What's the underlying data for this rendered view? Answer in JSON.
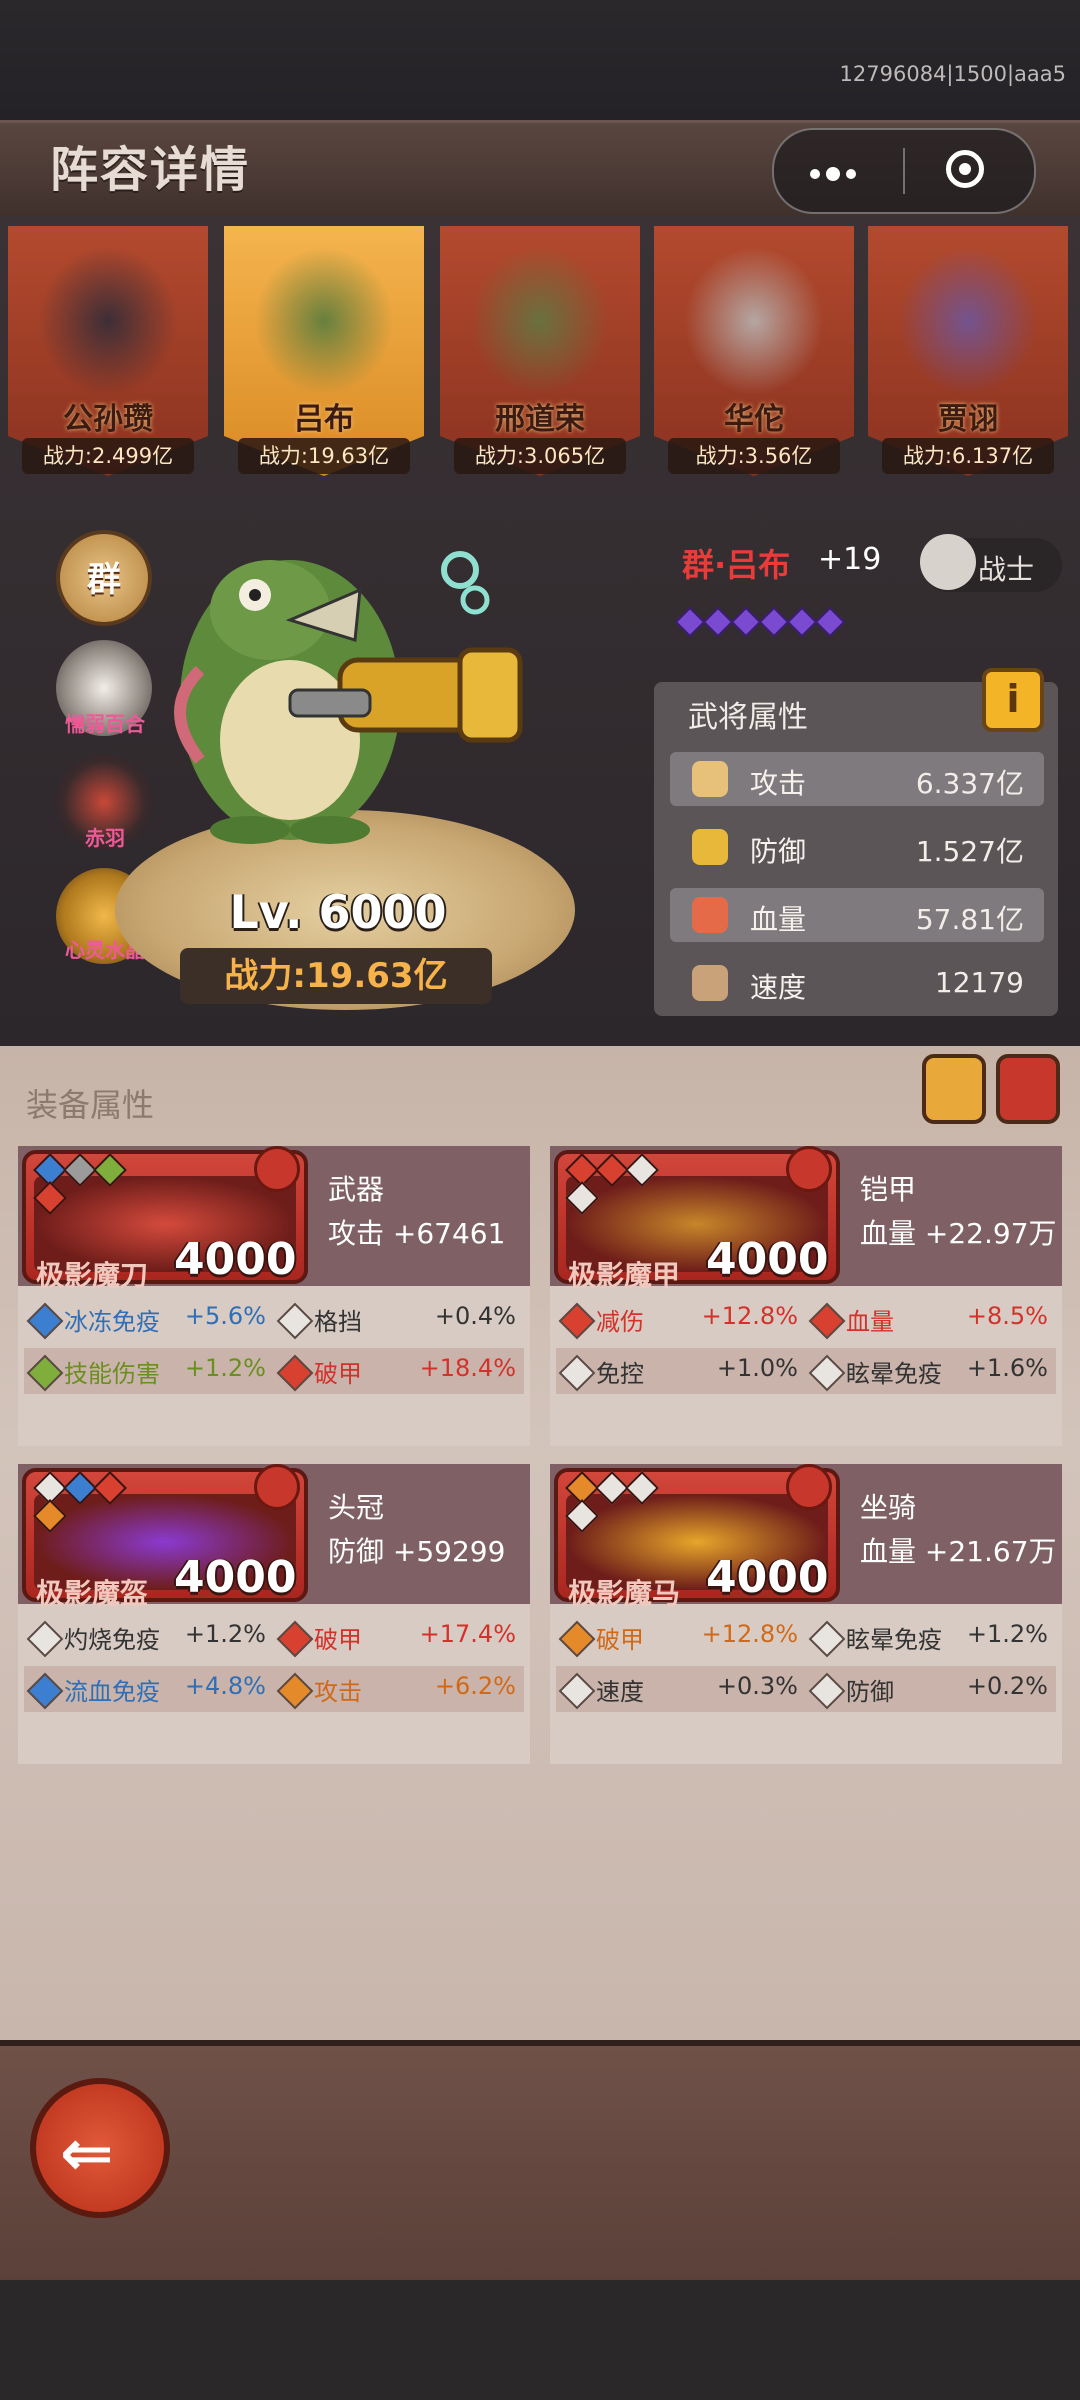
{
  "debug_text": "12796084|1500|aaa5",
  "title": "阵容详情",
  "capsule": {
    "more_icon": "more-dots-icon",
    "close_icon": "target-icon"
  },
  "heroes": [
    {
      "name": "公孙瓒",
      "power": "战力:2.499亿",
      "selected": false,
      "color": "#2b2b3a"
    },
    {
      "name": "吕布",
      "power": "战力:19.63亿",
      "selected": true,
      "color": "#4f7a3e"
    },
    {
      "name": "邢道荣",
      "power": "战力:3.065亿",
      "selected": false,
      "color": "#5f7a42"
    },
    {
      "name": "华佗",
      "power": "战力:3.56亿",
      "selected": false,
      "color": "#b8b8b8"
    },
    {
      "name": "贾诩",
      "power": "战力:6.137亿",
      "selected": false,
      "color": "#6b57a0"
    }
  ],
  "side": {
    "faction": "群",
    "skills": [
      {
        "label": "懦弱百合",
        "icon": "lily-icon"
      },
      {
        "label": "赤羽",
        "icon": "red-feather-icon"
      },
      {
        "label": "心灵水晶",
        "icon": "crystal-skull-icon"
      }
    ]
  },
  "hero_level": "Lv. 6000",
  "hero_power": "战力:19.63亿",
  "hero_title": "群·吕布",
  "hero_plus": "+19",
  "hero_class": "战士",
  "stats_panel": {
    "title": "武将属性",
    "info_label": "i",
    "stats": [
      {
        "name": "攻击",
        "value": "6.337亿",
        "icon": "sword-icon",
        "highlight": true
      },
      {
        "name": "防御",
        "value": "1.527亿",
        "icon": "shield-icon",
        "highlight": false
      },
      {
        "name": "血量",
        "value": "57.81亿",
        "icon": "blood-drop-icon",
        "highlight": true
      },
      {
        "name": "速度",
        "value": "12179",
        "icon": "boot-icon",
        "highlight": false
      }
    ]
  },
  "equipment": {
    "title": "装备属性",
    "items": [
      {
        "name": "极影魔刀",
        "level": "4000",
        "slot": "武器",
        "bonus": "攻击  +67461",
        "gems": [
          "#3c7fd1",
          "#9b9b9b",
          "#7fae3c",
          "#d84030"
        ],
        "subs": [
          [
            {
              "label": "冰冻免疫",
              "value": "+5.6%",
              "color": "#2f6fb7",
              "gem": "#3c7fd1"
            },
            {
              "label": "格挡",
              "value": "+0.4%",
              "color": "#333333",
              "gem": "#e8e4e0"
            }
          ],
          [
            {
              "label": "技能伤害",
              "value": "+1.2%",
              "color": "#6b8f1f",
              "gem": "#7fae3c"
            },
            {
              "label": "破甲",
              "value": "+18.4%",
              "color": "#d3322a",
              "gem": "#d84030"
            }
          ]
        ]
      },
      {
        "name": "极影魔甲",
        "level": "4000",
        "slot": "铠甲",
        "bonus": "血量 +22.97万",
        "gems": [
          "#d84030",
          "#d84030",
          "#e8e4e0",
          "#e8e4e0"
        ],
        "subs": [
          [
            {
              "label": "减伤",
              "value": "+12.8%",
              "color": "#d3322a",
              "gem": "#d84030"
            },
            {
              "label": "血量",
              "value": "+8.5%",
              "color": "#d3322a",
              "gem": "#d84030"
            }
          ],
          [
            {
              "label": "免控",
              "value": "+1.0%",
              "color": "#333333",
              "gem": "#e8e4e0"
            },
            {
              "label": "眩晕免疫",
              "value": "+1.6%",
              "color": "#333333",
              "gem": "#e8e4e0"
            }
          ]
        ]
      },
      {
        "name": "极影魔盔",
        "level": "4000",
        "slot": "头冠",
        "bonus": "防御  +59299",
        "gems": [
          "#e8e4e0",
          "#3c7fd1",
          "#d84030",
          "#e58a2a"
        ],
        "subs": [
          [
            {
              "label": "灼烧免疫",
              "value": "+1.2%",
              "color": "#333333",
              "gem": "#e8e4e0"
            },
            {
              "label": "破甲",
              "value": "+17.4%",
              "color": "#d3322a",
              "gem": "#d84030"
            }
          ],
          [
            {
              "label": "流血免疫",
              "value": "+4.8%",
              "color": "#2f6fb7",
              "gem": "#3c7fd1"
            },
            {
              "label": "攻击",
              "value": "+6.2%",
              "color": "#d06a18",
              "gem": "#e58a2a"
            }
          ]
        ]
      },
      {
        "name": "极影魔马",
        "level": "4000",
        "slot": "坐骑",
        "bonus": "血量 +21.67万",
        "gems": [
          "#e58a2a",
          "#e8e4e0",
          "#e8e4e0",
          "#e8e4e0"
        ],
        "subs": [
          [
            {
              "label": "破甲",
              "value": "+12.8%",
              "color": "#d06a18",
              "gem": "#e58a2a"
            },
            {
              "label": "眩晕免疫",
              "value": "+1.2%",
              "color": "#333333",
              "gem": "#e8e4e0"
            }
          ],
          [
            {
              "label": "速度",
              "value": "+0.3%",
              "color": "#333333",
              "gem": "#e8e4e0"
            },
            {
              "label": "防御",
              "value": "+0.2%",
              "color": "#333333",
              "gem": "#e8e4e0"
            }
          ]
        ]
      }
    ]
  },
  "back_icon": "back-arrow-icon"
}
